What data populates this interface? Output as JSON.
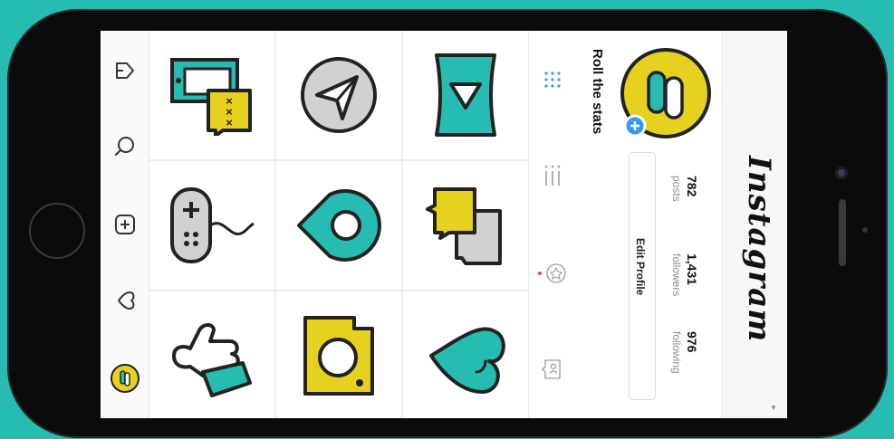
{
  "profile": {
    "username": "Roll the stats",
    "stats": [
      {
        "value": "782",
        "label": "posts"
      },
      {
        "value": "1,431",
        "label": "followers"
      },
      {
        "value": "976",
        "label": "following"
      }
    ],
    "edit_profile_label": "Edit Profile"
  },
  "header": {
    "brand": "Instagram"
  },
  "nav": {
    "items": [
      "home-icon",
      "search-icon",
      "add-post-icon",
      "activity-heart-icon",
      "profile-avatar-icon"
    ]
  },
  "tabs": {
    "items": [
      "grid-view-icon",
      "list-view-icon",
      "saved-icon",
      "tagged-icon"
    ]
  },
  "grid": {
    "tiles": [
      "chat-video-icon",
      "send-icon",
      "play-icon",
      "gamepad-icon",
      "location-pin-icon",
      "message-bubbles-icon",
      "thumbs-up-icon",
      "camera-icon",
      "heart-icon"
    ]
  },
  "colors": {
    "teal": "#26bcb1",
    "yellow": "#e6d11f",
    "gray": "#d0d1d3",
    "outline": "#2a2a2a",
    "badge_blue": "#3897f0"
  }
}
